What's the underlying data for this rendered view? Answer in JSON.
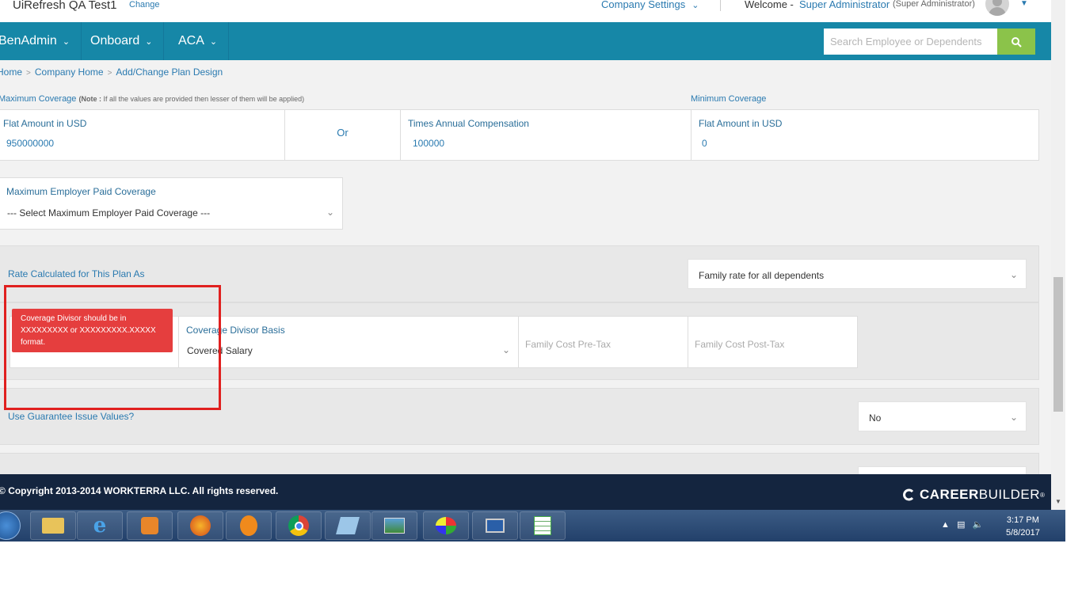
{
  "topbar": {
    "company_name": "UiRefresh QA Test1",
    "change_link": "Change",
    "company_settings": "Company Settings",
    "welcome": "Welcome -",
    "user_name": "Super Administrator",
    "user_role": "(Super Administrator)"
  },
  "nav": {
    "items": [
      {
        "label": "BenAdmin"
      },
      {
        "label": "Onboard"
      },
      {
        "label": "ACA"
      }
    ],
    "search_placeholder": "Search Employee or Dependents"
  },
  "breadcrumb": [
    "Home",
    "Company Home",
    "Add/Change Plan Design"
  ],
  "coverage": {
    "max_label": "Maximum Coverage",
    "max_note_bold": "(Note :",
    "max_note": "If all the values are provided then lesser of them will be applied)",
    "min_label": "Minimum Coverage",
    "flat_amount_label": "Flat Amount in USD",
    "flat_amount_value": "950000000",
    "or_label": "Or",
    "times_comp_label": "Times Annual Compensation",
    "times_comp_value": "100000",
    "min_flat_label": "Flat Amount in USD",
    "min_flat_value": "0"
  },
  "max_employer_paid": {
    "label": "Maximum Employer Paid Coverage",
    "selected": "--- Select Maximum Employer Paid Coverage ---"
  },
  "rate_calc": {
    "label": "Rate Calculated for This Plan As",
    "selected": "Family rate for all dependents"
  },
  "divisor": {
    "error": "Coverage Divisor should be in XXXXXXXXX or XXXXXXXXX.XXXXX format.",
    "basis_label": "Coverage Divisor Basis",
    "basis_selected": "Covered Salary",
    "pre_tax_placeholder": "Family Cost Pre-Tax",
    "post_tax_placeholder": "Family Cost Post-Tax"
  },
  "guarantee": {
    "label": "Use Guarantee Issue Values?",
    "selected": "No"
  },
  "footer": {
    "copyright": "Copyright 2013-2014 WORKTERRA LLC. All rights reserved.",
    "brand_bold": "CAREER",
    "brand_light": "BUILDER",
    "brand_mark": "®"
  },
  "taskbar": {
    "time": "3:17 PM",
    "date": "5/8/2017",
    "icons": [
      "windows-start-icon",
      "file-explorer-icon",
      "internet-explorer-icon",
      "media-player-icon",
      "firefox-icon",
      "flame-app-icon",
      "chrome-icon",
      "notepad-icon",
      "photo-viewer-icon",
      "paint-icon",
      "remote-desktop-icon",
      "spreadsheet-icon"
    ]
  },
  "colors": {
    "nav_bg": "#1687a7",
    "search_btn": "#8bc34a",
    "footer_bg": "#14253f",
    "link": "#2a7ab0",
    "error": "#e53e3e",
    "highlight": "#e0201f"
  }
}
